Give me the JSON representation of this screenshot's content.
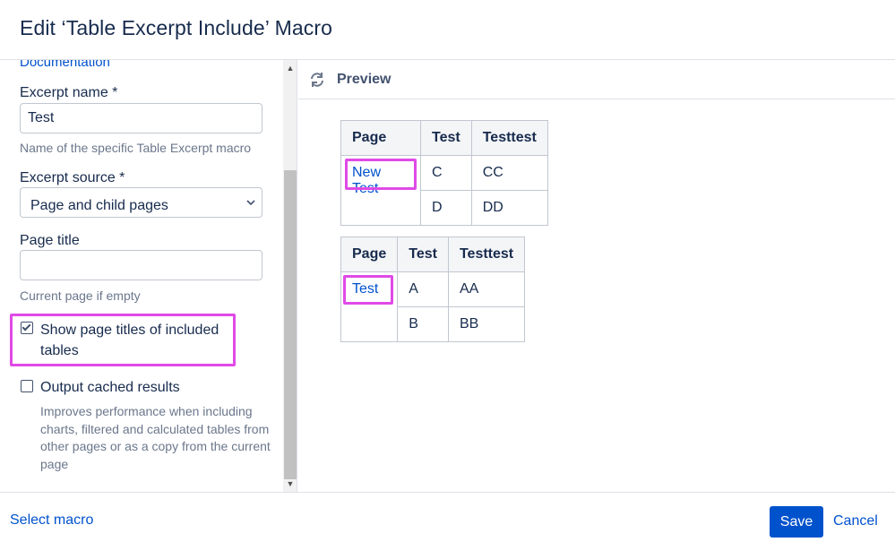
{
  "dialog": {
    "title": "Edit ‘Table Excerpt Include’ Macro"
  },
  "form": {
    "documentation_link": "Documentation",
    "excerpt_name": {
      "label": "Excerpt name *",
      "value": "Test",
      "help": "Name of the specific Table Excerpt macro"
    },
    "excerpt_source": {
      "label": "Excerpt source *",
      "selected": "Page and child pages"
    },
    "page_title": {
      "label": "Page title",
      "value": "",
      "help": "Current page if empty"
    },
    "show_titles": {
      "checked": true,
      "label_line1": "Show page titles of included",
      "label_line2": "tables"
    },
    "cached": {
      "checked": false,
      "label": "Output cached results",
      "help": "Improves performance when including charts, filtered and calculated tables from other pages or as a copy from the current page"
    }
  },
  "preview": {
    "label": "Preview",
    "tables": [
      {
        "headers": [
          "Page",
          "Test",
          "Testtest"
        ],
        "page_link": "New Test",
        "rows": [
          [
            "C",
            "CC"
          ],
          [
            "D",
            "DD"
          ]
        ]
      },
      {
        "headers": [
          "Page",
          "Test",
          "Testtest"
        ],
        "page_link": "Test",
        "rows": [
          [
            "A",
            "AA"
          ],
          [
            "B",
            "BB"
          ]
        ]
      }
    ]
  },
  "footer": {
    "select_macro": "Select macro",
    "save": "Save",
    "cancel": "Cancel"
  },
  "colors": {
    "accent": "#0052cc",
    "highlight": "#e04ae6"
  }
}
